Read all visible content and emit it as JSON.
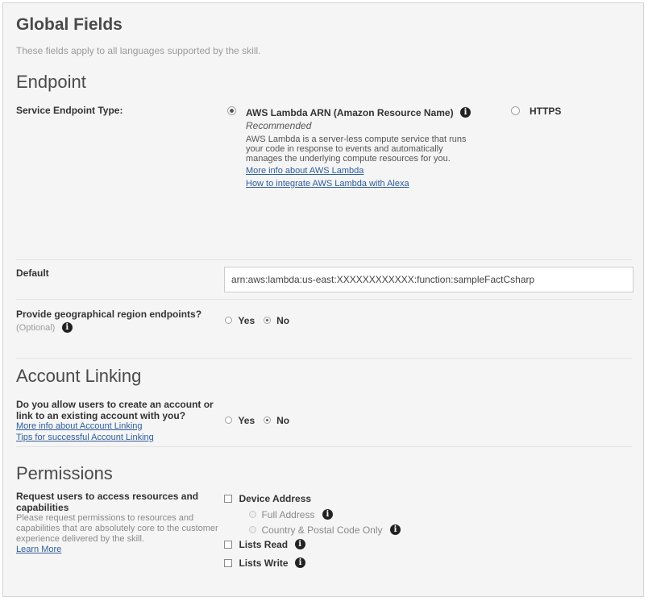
{
  "header": {
    "title": "Global Fields",
    "subtitle": "These fields apply to all languages supported by the skill."
  },
  "endpoint": {
    "heading": "Endpoint",
    "type_label": "Service Endpoint Type:",
    "options": [
      {
        "label": "AWS Lambda ARN (Amazon Resource Name)",
        "selected": true
      },
      {
        "label": "HTTPS",
        "selected": false
      }
    ],
    "recommended": "Recommended",
    "description": "AWS Lambda is a server-less compute service that runs your code in response to events and automatically manages the underlying compute resources for you.",
    "links": [
      "More info about AWS Lambda",
      "How to integrate AWS Lambda with Alexa"
    ],
    "default_label": "Default",
    "default_value": "arn:aws:lambda:us-east:XXXXXXXXXXXX:function:sampleFactCsharp",
    "geo_label": "Provide geographical region endpoints?",
    "geo_optional": "(Optional)",
    "geo_yes": "Yes",
    "geo_no": "No",
    "geo_selected": "No"
  },
  "account_linking": {
    "heading": "Account Linking",
    "question": "Do you allow users to create an account or link to an existing account with you?",
    "links": [
      "More info about Account Linking",
      "Tips for successful Account Linking"
    ],
    "yes": "Yes",
    "no": "No",
    "selected": "No"
  },
  "permissions": {
    "heading": "Permissions",
    "label": "Request users to access resources and capabilities",
    "description": "Please request permissions to resources and capabilities that are absolutely core to the customer experience delivered by the skill.",
    "learn_more": "Learn More",
    "items": {
      "device_address": "Device Address",
      "full_address": "Full Address",
      "country_postal": "Country & Postal Code Only",
      "lists_read": "Lists Read",
      "lists_write": "Lists Write"
    }
  },
  "icons": {
    "info": "info-icon"
  }
}
